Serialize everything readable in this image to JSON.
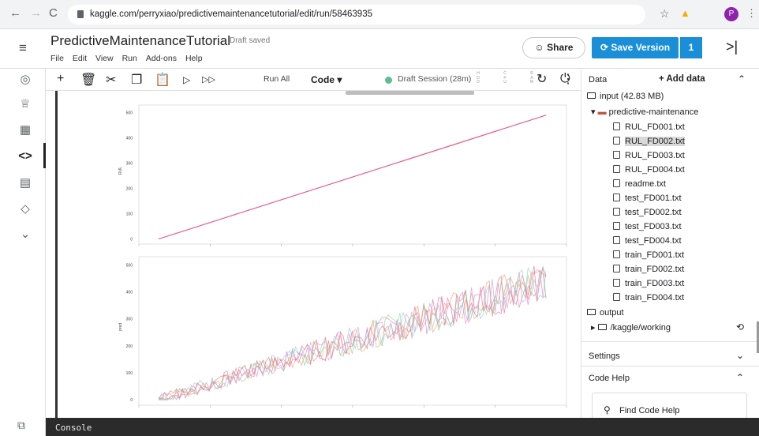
{
  "browser": {
    "url": "kaggle.com/perryxiao/predictivemaintenancetutorial/edit/run/58463935",
    "back": "←",
    "forward": "→",
    "reload": "C",
    "profile_initial": "P"
  },
  "notebook": {
    "title": "PredictiveMaintenanceTutorial",
    "status": "Draft saved",
    "menu": [
      "File",
      "Edit",
      "View",
      "Run",
      "Add-ons",
      "Help"
    ],
    "share_label": "Share",
    "save_label": "Save Version",
    "save_count": "1",
    "collapse_icon": ">|"
  },
  "toolbar": {
    "run_all": "Run All",
    "cell_type": "Code",
    "session": "Draft Session (28m)",
    "meters": [
      "H D D",
      "C P U",
      "R A M"
    ]
  },
  "sidebar_icons": [
    "compass-icon",
    "trophy-icon",
    "table-icon",
    "code-icon",
    "comment-icon",
    "school-icon",
    "chevron-down-icon"
  ],
  "panel": {
    "data_label": "Data",
    "add_data": "+ Add data",
    "input": "input (42.83 MB)",
    "dataset": "predictive-maintenance",
    "files": [
      "RUL_FD001.txt",
      "RUL_FD002.txt",
      "RUL_FD003.txt",
      "RUL_FD004.txt",
      "readme.txt",
      "test_FD001.txt",
      "test_FD002.txt",
      "test_FD003.txt",
      "test_FD004.txt",
      "train_FD001.txt",
      "train_FD002.txt",
      "train_FD003.txt",
      "train_FD004.txt"
    ],
    "selected_file": "RUL_FD002.txt",
    "output": "output",
    "working": "/kaggle/working",
    "settings": "Settings",
    "code_help": "Code Help",
    "find_help": "Find Code Help"
  },
  "console_label": "Console",
  "chart_data": [
    {
      "type": "line",
      "ylabel": "RUL",
      "yticks": [
        0,
        100,
        200,
        300,
        400,
        500
      ],
      "ylim": [
        -20,
        530
      ],
      "series": [
        {
          "x": [
            0,
            1
          ],
          "y": [
            0,
            490
          ]
        }
      ],
      "color": "#e8608a"
    },
    {
      "type": "line",
      "ylabel": "pred",
      "yticks": [
        0,
        100,
        200,
        300,
        400,
        500
      ],
      "ylim": [
        -20,
        530
      ],
      "trend": {
        "start": 0,
        "end": 440
      },
      "colors": [
        "#e377c2",
        "#8ecae6",
        "#90d18b",
        "#f4a261",
        "#c89bd8",
        "#e76f8a"
      ]
    }
  ]
}
